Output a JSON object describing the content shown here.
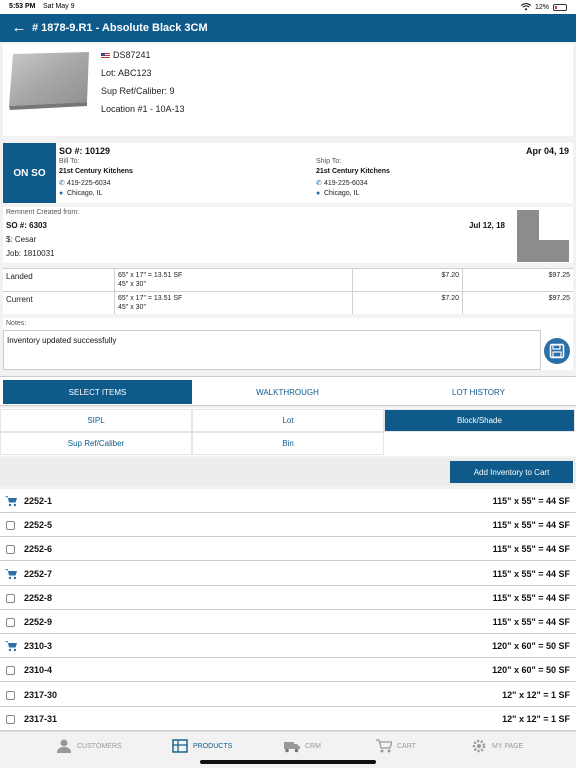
{
  "status_bar": {
    "time": "5:53 PM",
    "date": "Sat May 9",
    "battery": "12%"
  },
  "header": {
    "title": "# 1878-9.R1 - Absolute Black 3CM"
  },
  "product": {
    "code": "DS87241",
    "lot": "Lot: ABC123",
    "sup_ref": "Sup Ref/Caliber: 9",
    "location": "Location #1 - 10A-13"
  },
  "sales_order": {
    "badge": "ON SO",
    "number": "SO #: 10129",
    "date": "Apr 04, 19",
    "bill_to_label": "Bill To:",
    "bill_to_name": "21st Century Kitchens",
    "bill_to_phone": "419-225-6034",
    "bill_to_city": "Chicago, IL",
    "ship_to_label": "Ship To:",
    "ship_to_name": "21st Century Kitchens",
    "ship_to_phone": "419-225-6034",
    "ship_to_city": "Chicago, IL"
  },
  "remnant": {
    "label": "Remnent Created from:",
    "so": "SO #: 6303",
    "date": "Jul 12, 18",
    "amount": "$: Cesar",
    "job": "Job: 1810031"
  },
  "prices": [
    {
      "label": "Landed",
      "size1": "65\" x 17\" = 13.51 SF",
      "size2": "45\" x 30\"",
      "unit": "$7.20",
      "total": "$97.25"
    },
    {
      "label": "Current",
      "size1": "65\" x 17\" = 13.51 SF",
      "size2": "45\" x 30\"",
      "unit": "$7.20",
      "total": "$97.25"
    }
  ],
  "notes": {
    "label": "Notes:",
    "value": "Inventory updated successfully"
  },
  "tabs": [
    {
      "label": "SELECT ITEMS",
      "active": true
    },
    {
      "label": "WALKTHROUGH",
      "active": false
    },
    {
      "label": "LOT HISTORY",
      "active": false
    }
  ],
  "filters": [
    {
      "label": "SIPL",
      "active": false
    },
    {
      "label": "Lot",
      "active": false
    },
    {
      "label": "Block/Shade",
      "active": true
    },
    {
      "label": "Sup Ref/Caliber",
      "active": false
    },
    {
      "label": "Bin",
      "active": false
    }
  ],
  "add_button": "Add Inventory to Cart",
  "items": [
    {
      "id": "2252-1",
      "dims": "115\" x 55\" = 44 SF",
      "in_cart": true
    },
    {
      "id": "2252-5",
      "dims": "115\" x 55\" = 44 SF",
      "in_cart": false
    },
    {
      "id": "2252-6",
      "dims": "115\" x 55\" = 44 SF",
      "in_cart": false
    },
    {
      "id": "2252-7",
      "dims": "115\" x 55\" = 44 SF",
      "in_cart": true
    },
    {
      "id": "2252-8",
      "dims": "115\" x 55\" = 44 SF",
      "in_cart": false
    },
    {
      "id": "2252-9",
      "dims": "115\" x 55\" = 44 SF",
      "in_cart": false
    },
    {
      "id": "2310-3",
      "dims": "120\" x 60\" = 50 SF",
      "in_cart": true
    },
    {
      "id": "2310-4",
      "dims": "120\" x 60\" = 50 SF",
      "in_cart": false
    },
    {
      "id": "2317-30",
      "dims": "12\" x 12\" = 1 SF",
      "in_cart": false
    },
    {
      "id": "2317-31",
      "dims": "12\" x 12\" = 1 SF",
      "in_cart": false
    }
  ],
  "bottom_nav": [
    {
      "label": "CUSTOMERS",
      "icon": "person-icon",
      "active": false
    },
    {
      "label": "PRODUCTS",
      "icon": "products-icon",
      "active": true
    },
    {
      "label": "CRM",
      "icon": "truck-icon",
      "active": false
    },
    {
      "label": "CART",
      "icon": "cart-icon",
      "active": false
    },
    {
      "label": "MY PAGE",
      "icon": "gear-icon",
      "active": false
    }
  ],
  "colors": {
    "primary": "#0e5a8a",
    "accent": "#2a6fa8"
  }
}
